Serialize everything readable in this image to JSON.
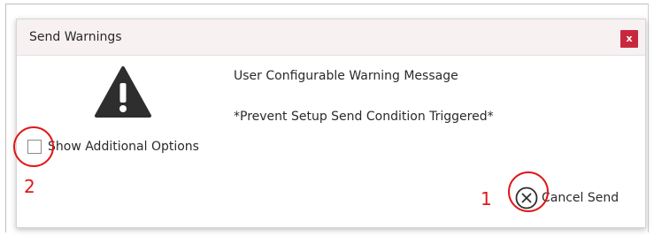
{
  "dialog": {
    "title": "Send Warnings",
    "close_label": "x",
    "icon": "warning-triangle-icon",
    "message_line_1": "User Configurable Warning Message",
    "message_line_2": "*Prevent Setup Send Condition Triggered*",
    "show_options_label": "Show Additional Options",
    "show_options_checked": false,
    "cancel_icon": "circle-x-icon",
    "cancel_label": "Cancel Send"
  },
  "annotations": {
    "marker_1": "1",
    "marker_2": "2",
    "color": "#e01818"
  },
  "colors": {
    "titlebar_bg": "#f7f1f2",
    "close_button_bg": "#c8283e",
    "icon_dark": "#2e2e2e"
  }
}
